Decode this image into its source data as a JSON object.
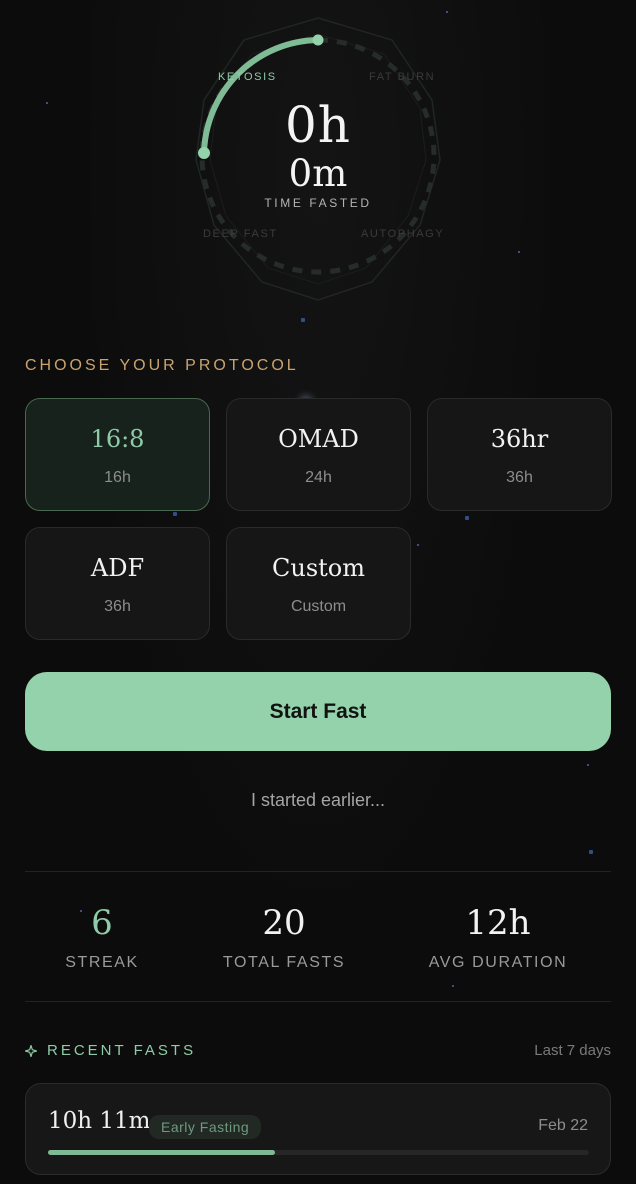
{
  "hero": {
    "phases": {
      "ketosis": "KETOSIS",
      "fat_burn": "FAT BURN",
      "deep_fast": "DEEP FAST",
      "autophagy": "AUTOPHAGY"
    },
    "hours": "0h",
    "minutes": "0m",
    "label": "TIME FASTED"
  },
  "protocol": {
    "title": "CHOOSE YOUR PROTOCOL",
    "options": [
      {
        "name": "16:8",
        "duration": "16h",
        "selected": true
      },
      {
        "name": "OMAD",
        "duration": "24h",
        "selected": false
      },
      {
        "name": "36hr",
        "duration": "36h",
        "selected": false
      },
      {
        "name": "ADF",
        "duration": "36h",
        "selected": false
      },
      {
        "name": "Custom",
        "duration": "Custom",
        "selected": false
      }
    ]
  },
  "actions": {
    "start_label": "Start Fast",
    "earlier_label": "I started earlier..."
  },
  "stats": [
    {
      "value": "6",
      "label": "STREAK"
    },
    {
      "value": "20",
      "label": "TOTAL FASTS"
    },
    {
      "value": "12h",
      "label": "AVG DURATION"
    }
  ],
  "recent": {
    "icon": "sparkle-icon",
    "title": "RECENT FASTS",
    "range": "Last 7 days",
    "items": [
      {
        "duration": "10h 11m",
        "badge": "Early Fasting",
        "date": "Feb 22",
        "progress": 0.42
      }
    ]
  },
  "colors": {
    "accent": "#93d2ab",
    "section_gold": "#c9a46e",
    "background": "#0c0c0c"
  }
}
